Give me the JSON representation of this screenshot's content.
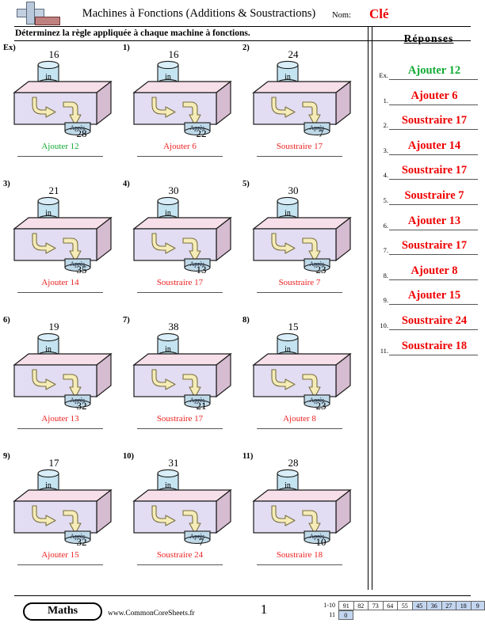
{
  "header": {
    "title": "Machines à Fonctions (Additions & Soustractions)",
    "name_label": "Nom:",
    "name_value": "Clé",
    "instructions": "Déterminez la règle appliquée à chaque machine à fonctions.",
    "logo_name": "plus-minus-logo"
  },
  "machine": {
    "input_label": "in",
    "output_label": "Après"
  },
  "problems": [
    {
      "num": "Ex)",
      "input": "16",
      "output": "28",
      "rule": "Ajouter 12",
      "is_example": true
    },
    {
      "num": "1)",
      "input": "16",
      "output": "22",
      "rule": "Ajouter 6",
      "is_example": false
    },
    {
      "num": "2)",
      "input": "24",
      "output": "7",
      "rule": "Soustraire 17",
      "is_example": false
    },
    {
      "num": "3)",
      "input": "21",
      "output": "35",
      "rule": "Ajouter 14",
      "is_example": false
    },
    {
      "num": "4)",
      "input": "30",
      "output": "13",
      "rule": "Soustraire 17",
      "is_example": false
    },
    {
      "num": "5)",
      "input": "30",
      "output": "23",
      "rule": "Soustraire 7",
      "is_example": false
    },
    {
      "num": "6)",
      "input": "19",
      "output": "32",
      "rule": "Ajouter 13",
      "is_example": false
    },
    {
      "num": "7)",
      "input": "38",
      "output": "21",
      "rule": "Soustraire 17",
      "is_example": false
    },
    {
      "num": "8)",
      "input": "15",
      "output": "23",
      "rule": "Ajouter 8",
      "is_example": false
    },
    {
      "num": "9)",
      "input": "17",
      "output": "32",
      "rule": "Ajouter 15",
      "is_example": false
    },
    {
      "num": "10)",
      "input": "31",
      "output": "7",
      "rule": "Soustraire 24",
      "is_example": false
    },
    {
      "num": "11)",
      "input": "28",
      "output": "10",
      "rule": "Soustraire 18",
      "is_example": false
    }
  ],
  "answers": {
    "title": "Réponses",
    "items": [
      {
        "num": "Ex.",
        "value": "Ajouter 12",
        "is_example": true
      },
      {
        "num": "1.",
        "value": "Ajouter 6",
        "is_example": false
      },
      {
        "num": "2.",
        "value": "Soustraire 17",
        "is_example": false
      },
      {
        "num": "3.",
        "value": "Ajouter 14",
        "is_example": false
      },
      {
        "num": "4.",
        "value": "Soustraire 17",
        "is_example": false
      },
      {
        "num": "5.",
        "value": "Soustraire 7",
        "is_example": false
      },
      {
        "num": "6.",
        "value": "Ajouter 13",
        "is_example": false
      },
      {
        "num": "7.",
        "value": "Soustraire 17",
        "is_example": false
      },
      {
        "num": "8.",
        "value": "Ajouter 8",
        "is_example": false
      },
      {
        "num": "9.",
        "value": "Ajouter 15",
        "is_example": false
      },
      {
        "num": "10.",
        "value": "Soustraire 24",
        "is_example": false
      },
      {
        "num": "11.",
        "value": "Soustraire 18",
        "is_example": false
      }
    ]
  },
  "footer": {
    "subject": "Maths",
    "site": "www.CommonCoreSheets.fr",
    "page": "1",
    "score_table": {
      "row1_label": "1-10",
      "row1_values": [
        "91",
        "82",
        "73",
        "64",
        "55",
        "45",
        "36",
        "27",
        "18",
        "9"
      ],
      "row1_highlight_from": 5,
      "row2_label": "11",
      "row2_values": [
        "0"
      ],
      "row2_highlight_from": 0
    }
  },
  "colors": {
    "answer_red": "#ee0000",
    "example_green": "#11aa33",
    "box_front": "#e2ddf2",
    "box_top": "#f6dfe9",
    "box_side": "#d6bcd0",
    "cylinder": "#c5e4f2",
    "arrow": "#f5ecb8"
  }
}
